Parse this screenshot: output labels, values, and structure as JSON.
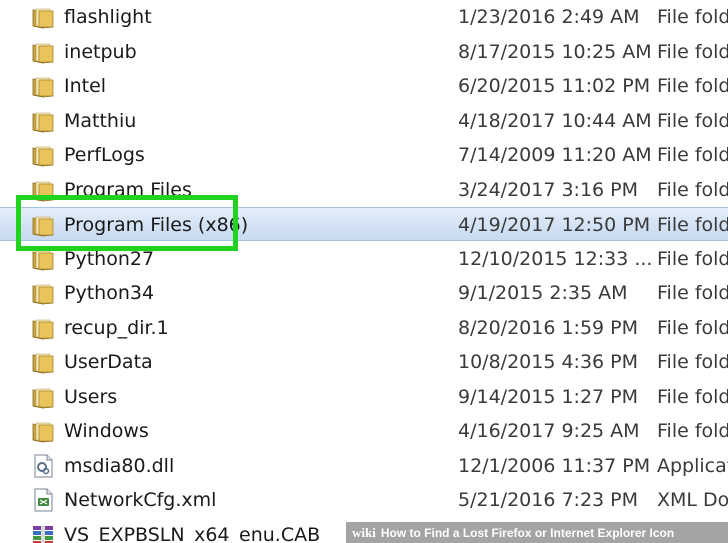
{
  "files": [
    {
      "name": "flashlight",
      "date": "1/23/2016 2:49 AM",
      "type": "File fold",
      "icon": "folder-icon",
      "selected": false
    },
    {
      "name": "inetpub",
      "date": "8/17/2015 10:25 AM",
      "type": "File fold",
      "icon": "folder-icon",
      "selected": false
    },
    {
      "name": "Intel",
      "date": "6/20/2015 11:02 PM",
      "type": "File fold",
      "icon": "folder-icon",
      "selected": false
    },
    {
      "name": "Matthiu",
      "date": "4/18/2017 10:44 AM",
      "type": "File fold",
      "icon": "folder-icon",
      "selected": false
    },
    {
      "name": "PerfLogs",
      "date": "7/14/2009 11:20 AM",
      "type": "File fold",
      "icon": "folder-icon",
      "selected": false
    },
    {
      "name": "Program Files",
      "date": "3/24/2017 3:16 PM",
      "type": "File fold",
      "icon": "folder-icon",
      "selected": false
    },
    {
      "name": "Program Files (x86)",
      "date": "4/19/2017 12:50 PM",
      "type": "File fold",
      "icon": "folder-icon",
      "selected": true
    },
    {
      "name": "Python27",
      "date": "12/10/2015 12:33 ...",
      "type": "File fold",
      "icon": "folder-icon",
      "selected": false
    },
    {
      "name": "Python34",
      "date": "9/1/2015 2:35 AM",
      "type": "File fold",
      "icon": "folder-icon",
      "selected": false
    },
    {
      "name": "recup_dir.1",
      "date": "8/20/2016 1:59 PM",
      "type": "File fold",
      "icon": "folder-icon",
      "selected": false
    },
    {
      "name": "UserData",
      "date": "10/8/2015 4:36 PM",
      "type": "File fold",
      "icon": "folder-icon",
      "selected": false
    },
    {
      "name": "Users",
      "date": "9/14/2015 1:27 PM",
      "type": "File fold",
      "icon": "folder-icon",
      "selected": false
    },
    {
      "name": "Windows",
      "date": "4/16/2017 9:25 AM",
      "type": "File fold",
      "icon": "folder-icon",
      "selected": false
    },
    {
      "name": "msdia80.dll",
      "date": "12/1/2006 11:37 PM",
      "type": "Applicat",
      "icon": "dll-file-icon",
      "selected": false
    },
    {
      "name": "NetworkCfg.xml",
      "date": "5/21/2016 7:23 PM",
      "type": "XML Do",
      "icon": "xml-file-icon",
      "selected": false
    },
    {
      "name": "VS_EXPBSLN_x64_enu.CAB",
      "date": "",
      "type": "",
      "icon": "cab-archive-icon",
      "selected": false
    }
  ],
  "colors": {
    "highlight_border": "#21d21e",
    "selection_fill": "#d3e2f4",
    "folder_yellow": "#e8c45a"
  },
  "watermark": {
    "brand": "wiki",
    "title": "How to Find a Lost Firefox or Internet Explorer Icon"
  }
}
